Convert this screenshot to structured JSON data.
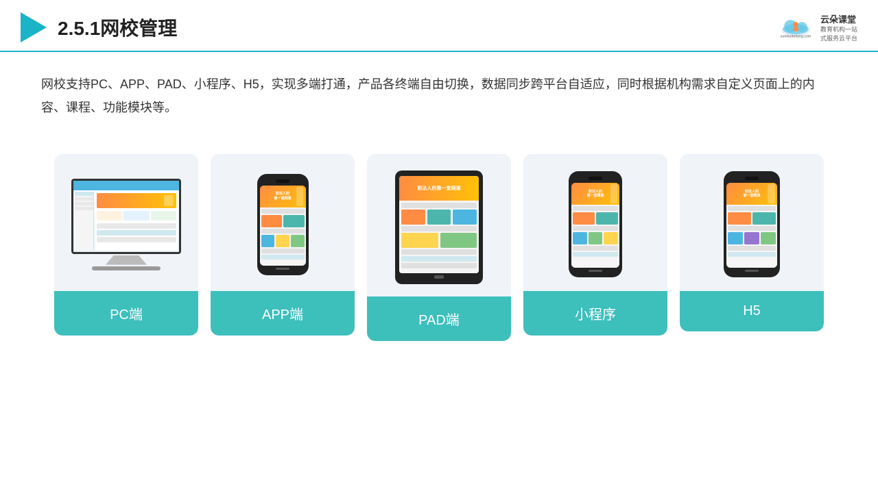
{
  "header": {
    "title": "2.5.1网校管理",
    "logo_name": "云朵课堂",
    "logo_sub": "教育机构一站\n式服务云平台",
    "logo_url": "yunduoketang.com"
  },
  "description": {
    "text": "网校支持PC、APP、PAD、小程序、H5，实现多端打通，产品各终端自由切换，数据同步跨平台自适应，同时根据机构需求自定义页面上的内容、课程、功能模块等。"
  },
  "cards": [
    {
      "id": "pc",
      "label": "PC端"
    },
    {
      "id": "app",
      "label": "APP端"
    },
    {
      "id": "pad",
      "label": "PAD端"
    },
    {
      "id": "miniprogram",
      "label": "小程序"
    },
    {
      "id": "h5",
      "label": "H5"
    }
  ],
  "colors": {
    "accent": "#3dbfbc",
    "header_line": "#1ab3c8",
    "card_bg": "#f0f4f8",
    "play_icon": "#1ab3c8"
  }
}
